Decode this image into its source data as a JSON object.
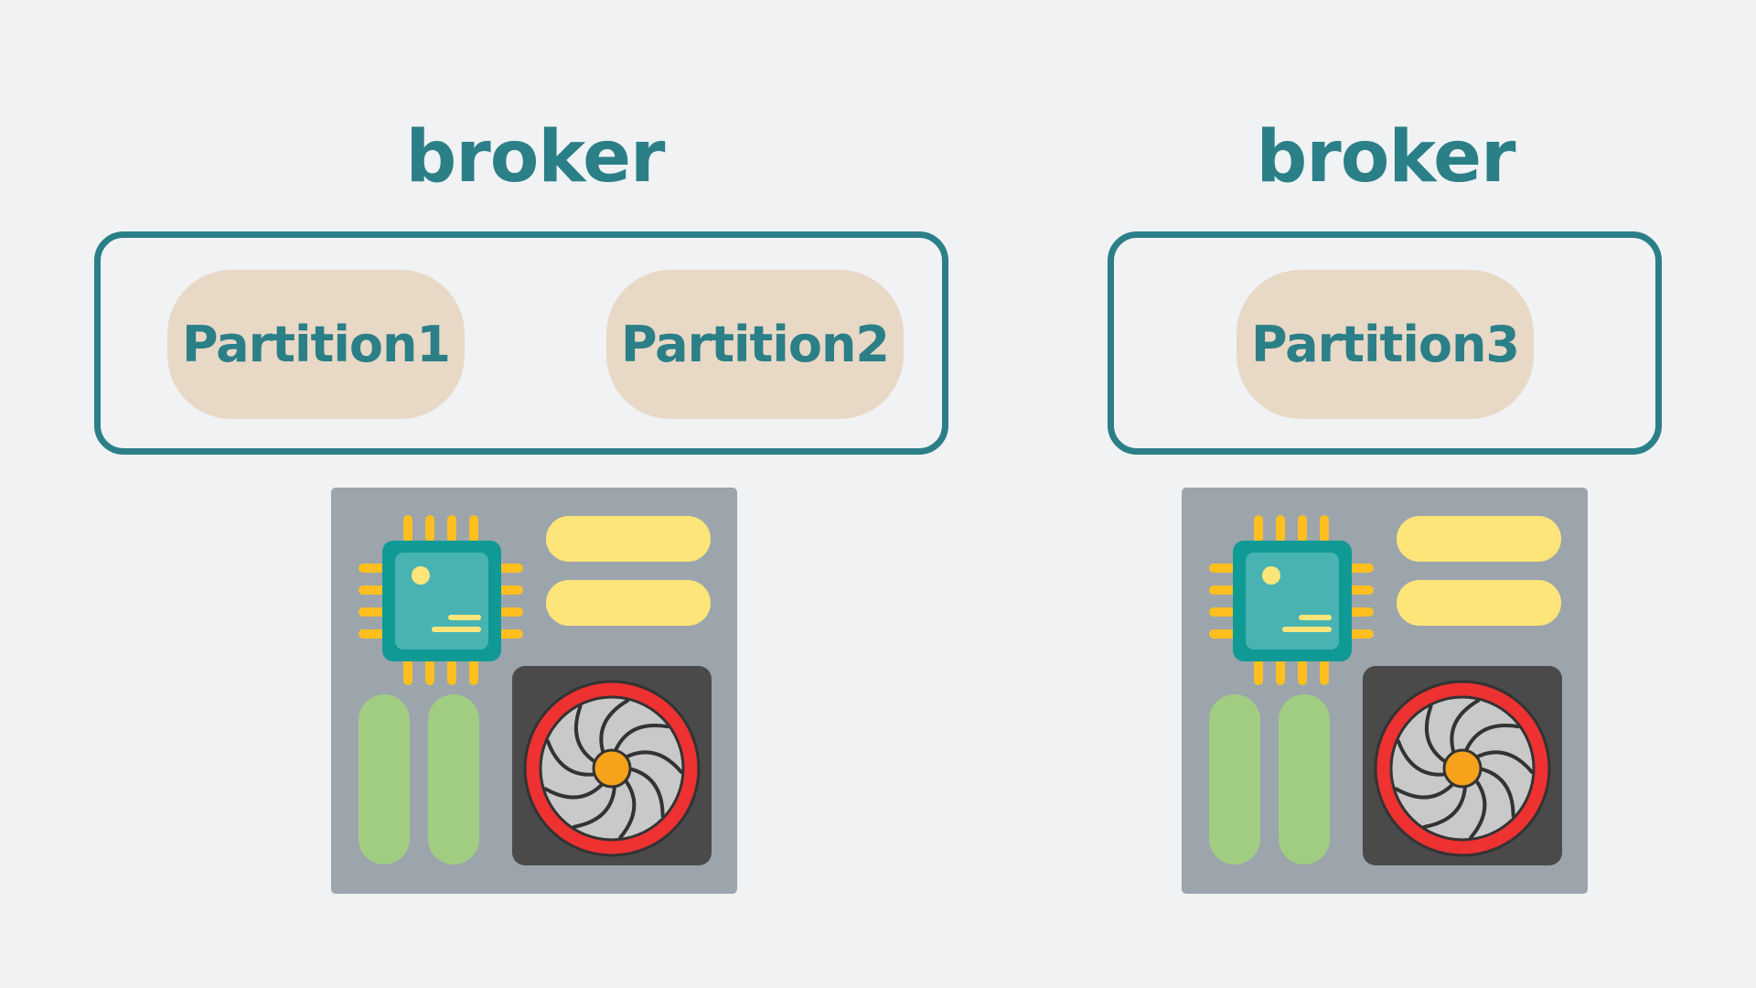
{
  "brokers": [
    {
      "title": "broker",
      "partitions": [
        "Partition1",
        "Partition2"
      ]
    },
    {
      "title": "broker",
      "partitions": [
        "Partition3"
      ]
    }
  ],
  "colors": {
    "background": "#f0f2f4",
    "accent": "#2b7f87",
    "partition_fill": "#e8d8c6",
    "board": "#9ba5ab",
    "chip": "#0f9a96",
    "chip_core": "#48b3b2",
    "pins": "#ffbf1f",
    "ram": "#fde57a",
    "slot": "#a1cd82",
    "fan_housing": "#4a4a4a",
    "fan_ring": "#ee3131",
    "fan_blades": "#c9c9c9",
    "fan_hub": "#f7a21b"
  },
  "icons": {
    "server": "server-motherboard-icon"
  }
}
